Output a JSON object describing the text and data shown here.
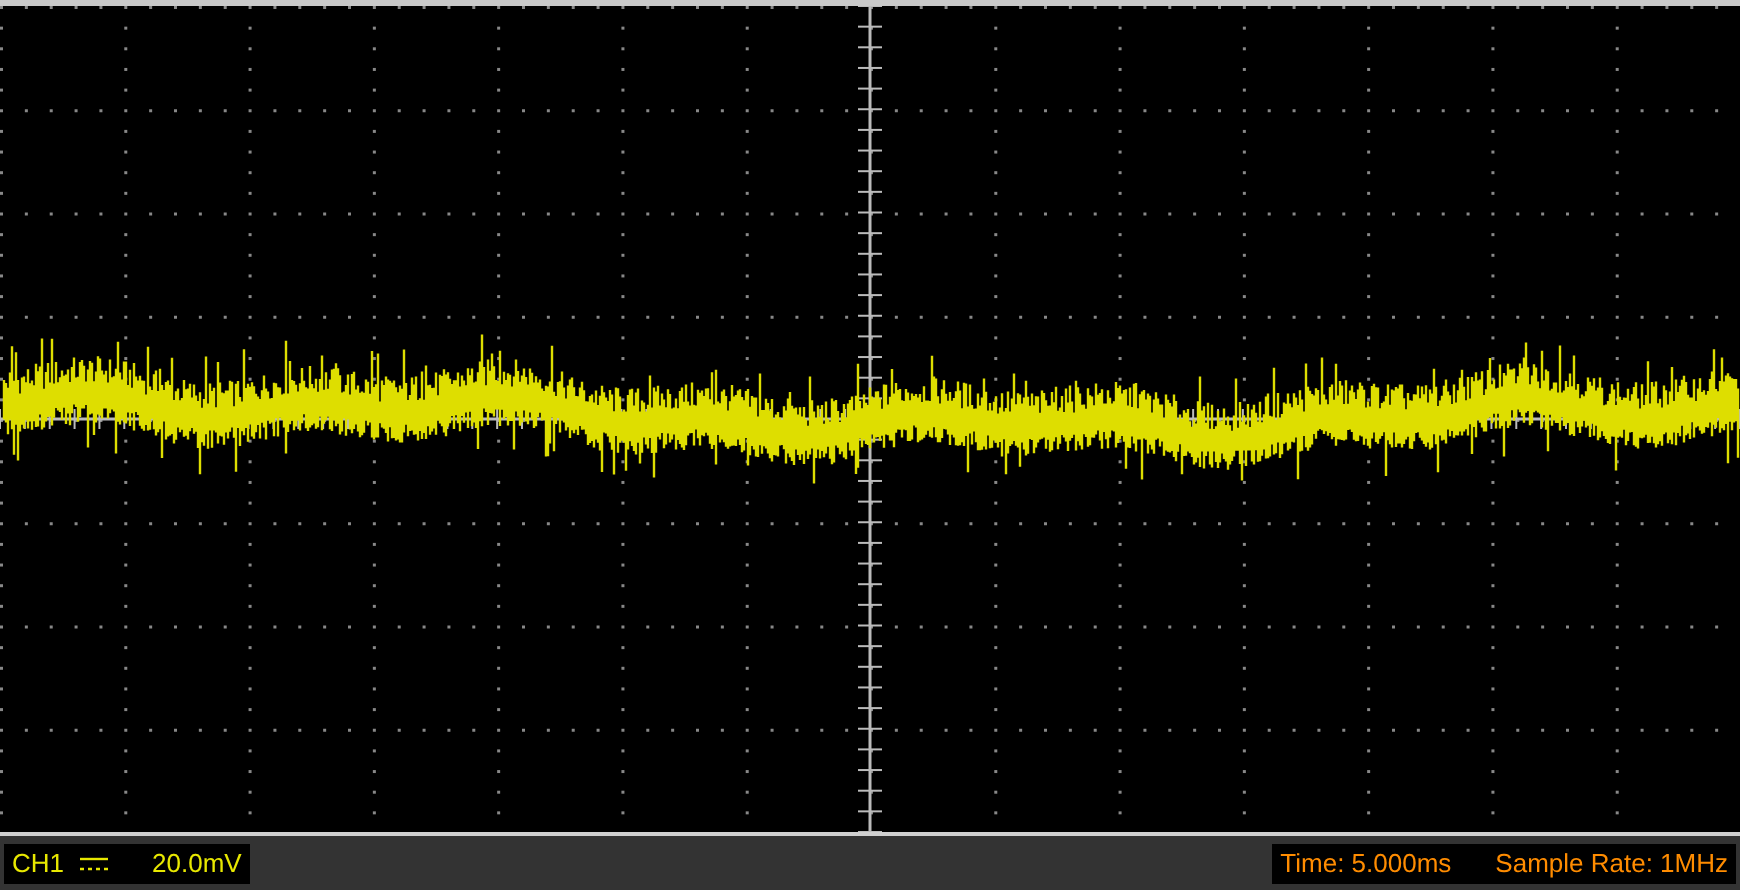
{
  "status_bar": {
    "channel": "CH1",
    "scale": "20.0mV",
    "time": "Time: 5.000ms",
    "sample_rate": "Sample Rate: 1MHz"
  }
}
